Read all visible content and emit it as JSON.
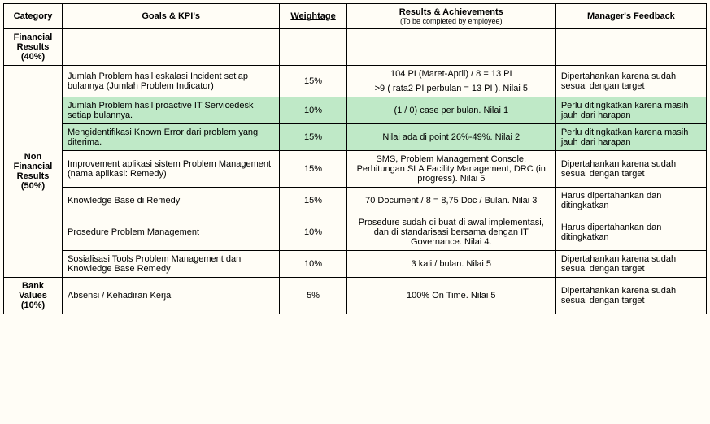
{
  "headers": {
    "category": "Category",
    "goals": "Goals & KPI's",
    "weightage": "Weightage",
    "results": "Results & Achievements",
    "results_sub": "(To be completed by employee)",
    "feedback": "Manager's Feedback"
  },
  "categories": {
    "financial": "Financial Results (40%)",
    "nonfinancial": "Non Financial Results (50%)",
    "bank": "Bank Values (10%)"
  },
  "rows": {
    "r1": {
      "goal": "Jumlah Problem hasil eskalasi Incident setiap bulannya (Jumlah Problem Indicator)",
      "weight": "15%",
      "result_a": "104 PI (Maret-April) / 8 = 13 PI",
      "result_b": ">9 ( rata2 PI perbulan = 13 PI ). Nilai 5",
      "feedback": "Dipertahankan karena sudah sesuai dengan target"
    },
    "r2": {
      "goal": "Jumlah Problem hasil proactive IT Servicedesk setiap bulannya.",
      "weight": "10%",
      "result": "(1 / 0) case per bulan.  Nilai 1",
      "feedback": "Perlu ditingkatkan karena masih jauh dari harapan"
    },
    "r3": {
      "goal": "Mengidentifikasi Known Error dari problem yang  diterima.",
      "weight": "15%",
      "result": "Nilai ada di point 26%-49%. Nilai 2",
      "feedback": "Perlu ditingkatkan karena masih jauh dari harapan"
    },
    "r4": {
      "goal": "Improvement aplikasi sistem Problem Management (nama aplikasi: Remedy)",
      "weight": "15%",
      "result": "SMS, Problem Management Console, Perhitungan SLA Facility Management, DRC (in progress). Nilai 5",
      "feedback": "Dipertahankan karena sudah sesuai dengan target"
    },
    "r5": {
      "goal": "Knowledge Base di Remedy",
      "weight": "15%",
      "result": "70 Document / 8 = 8,75 Doc / Bulan. Nilai 3",
      "feedback": "Harus dipertahankan dan ditingkatkan"
    },
    "r6": {
      "goal": "Prosedure Problem Management",
      "weight": "10%",
      "result": "Prosedure sudah di buat di awal implementasi, dan di standarisasi bersama dengan IT Governance. Nilai 4.",
      "feedback": "Harus dipertahankan dan ditingkatkan"
    },
    "r7": {
      "goal": "Sosialisasi  Tools Problem Management dan Knowledge Base Remedy",
      "weight": "10%",
      "result": "3 kali / bulan. Nilai 5",
      "feedback": "Dipertahankan karena sudah sesuai dengan target"
    },
    "r8": {
      "goal": "Absensi  / Kehadiran Kerja",
      "weight": "5%",
      "result": "100% On Time. Nilai 5",
      "feedback": "Dipertahankan karena sudah sesuai dengan target"
    }
  }
}
